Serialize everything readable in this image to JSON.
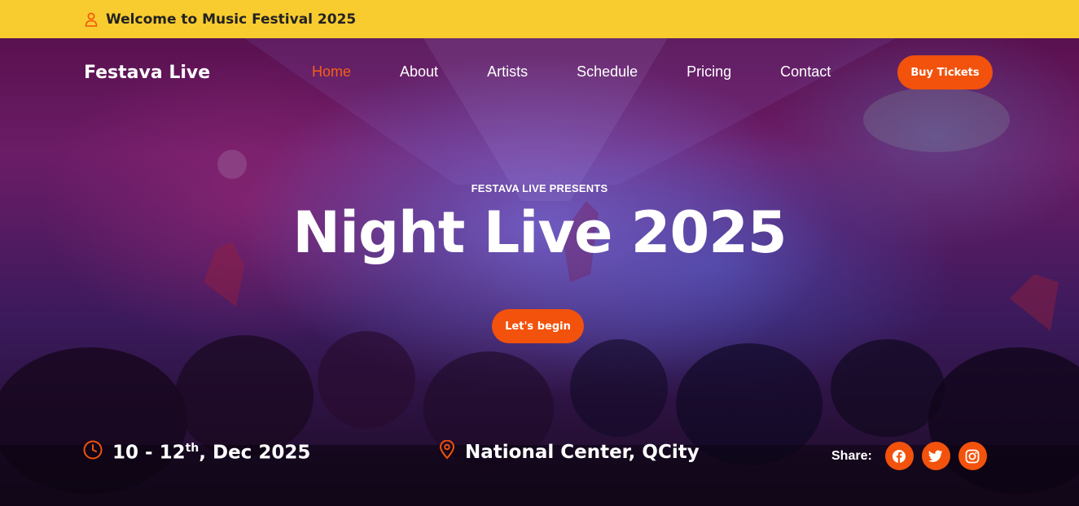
{
  "topbar": {
    "welcome": "Welcome to Music Festival 2025"
  },
  "header": {
    "brand": "Festava Live",
    "nav": [
      {
        "label": "Home",
        "active": true
      },
      {
        "label": "About",
        "active": false
      },
      {
        "label": "Artists",
        "active": false
      },
      {
        "label": "Schedule",
        "active": false
      },
      {
        "label": "Pricing",
        "active": false
      },
      {
        "label": "Contact",
        "active": false
      }
    ],
    "buy_tickets_label": "Buy Tickets"
  },
  "hero": {
    "presents": "FESTAVA LIVE PRESENTS",
    "title": "Night Live 2025",
    "cta_label": "Let's begin"
  },
  "info": {
    "date_prefix": "10 - 12",
    "date_sup": "th",
    "date_suffix": ", Dec 2025",
    "location": "National Center, QCity"
  },
  "share": {
    "label": "Share:",
    "icons": [
      "facebook-icon",
      "twitter-icon",
      "instagram-icon"
    ]
  },
  "colors": {
    "accent": "#f2520c",
    "topbar_bg": "#f8cb2e",
    "nav_active": "#f65e14"
  }
}
